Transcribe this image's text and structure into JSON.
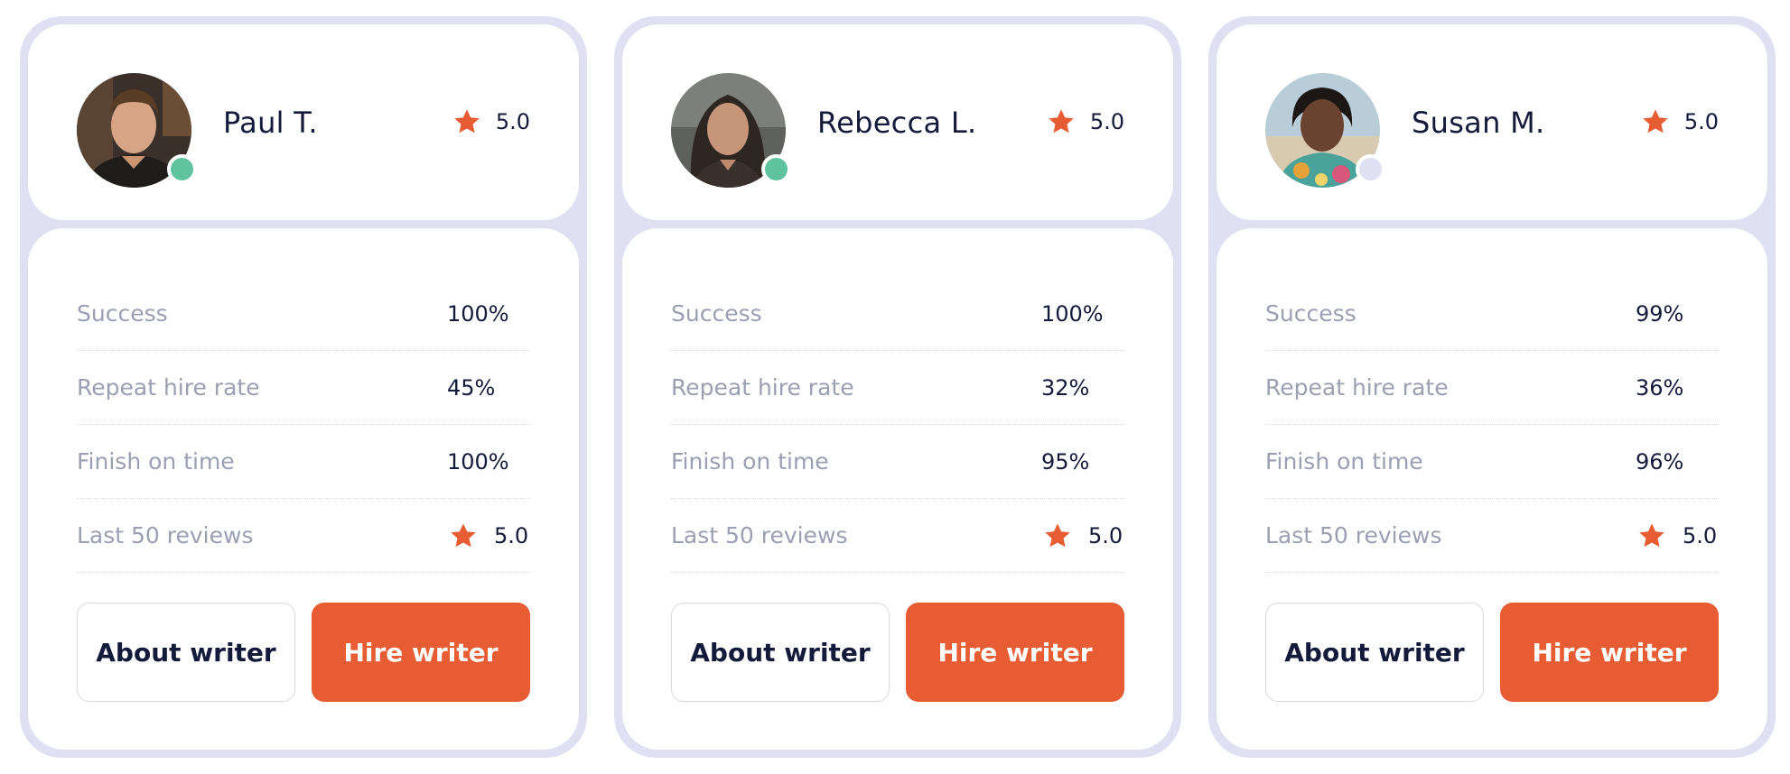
{
  "accent_color": "#e85c33",
  "online_color": "#5fc3a0",
  "offline_color": "#dfe1f3",
  "writers": [
    {
      "name": "Paul T.",
      "rating": "5.0",
      "status": "online",
      "stats": [
        {
          "label": "Success",
          "value": "100%"
        },
        {
          "label": "Repeat hire rate",
          "value": "45%"
        },
        {
          "label": "Finish on time",
          "value": "100%"
        },
        {
          "label": "Last 50 reviews",
          "value": "5.0"
        }
      ],
      "about_label": "About writer",
      "hire_label": "Hire writer"
    },
    {
      "name": "Rebecca L.",
      "rating": "5.0",
      "status": "online",
      "stats": [
        {
          "label": "Success",
          "value": "100%"
        },
        {
          "label": "Repeat hire rate",
          "value": "32%"
        },
        {
          "label": "Finish on time",
          "value": "95%"
        },
        {
          "label": "Last 50 reviews",
          "value": "5.0"
        }
      ],
      "about_label": "About writer",
      "hire_label": "Hire writer"
    },
    {
      "name": "Susan M.",
      "rating": "5.0",
      "status": "offline",
      "stats": [
        {
          "label": "Success",
          "value": "99%"
        },
        {
          "label": "Repeat hire rate",
          "value": "36%"
        },
        {
          "label": "Finish on time",
          "value": "96%"
        },
        {
          "label": "Last 50 reviews",
          "value": "5.0"
        }
      ],
      "about_label": "About writer",
      "hire_label": "Hire writer"
    }
  ]
}
